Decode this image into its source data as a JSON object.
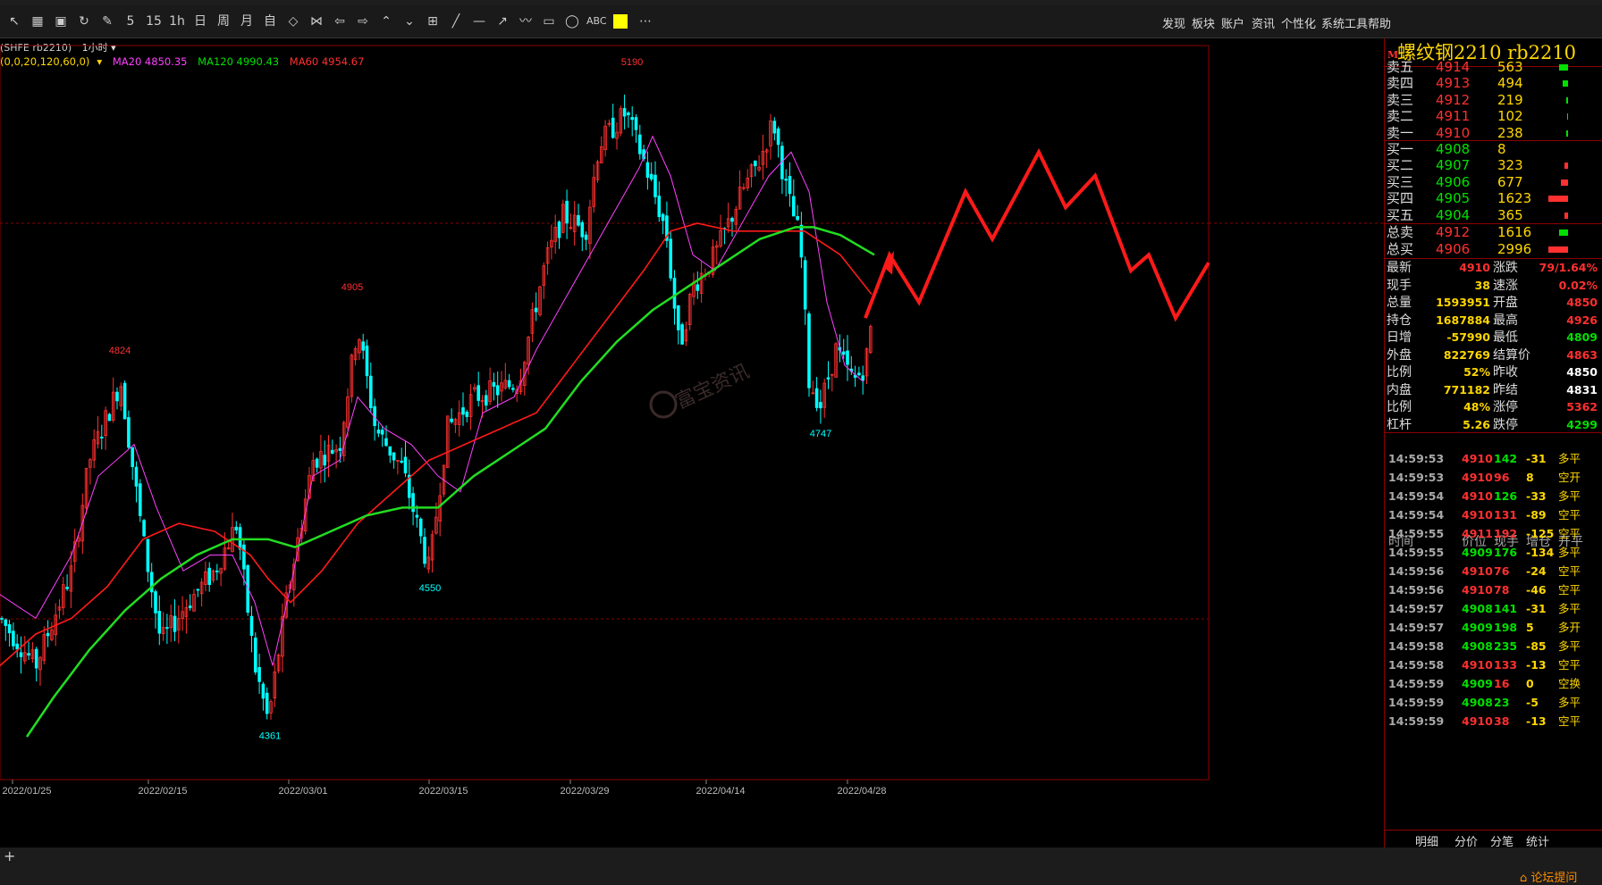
{
  "toolbar": {
    "tools": [
      "cursor-icon",
      "layout-icon",
      "save-icon",
      "refresh-icon",
      "draw-icon",
      "5",
      "15",
      "1h",
      "日",
      "周",
      "月",
      "自",
      "zoom-in-icon",
      "zoom-out-icon",
      "arrow-left-icon",
      "arrow-right-icon",
      "arrow-up-icon",
      "arrow-down-icon",
      "grid-icon",
      "line-icon",
      "hline-icon",
      "ray-icon",
      "wave-icon",
      "rect-icon",
      "ellipse-icon",
      "ABC",
      "color-swatch",
      "more-icon"
    ],
    "menu": [
      "发现",
      "板块",
      "账户",
      "资讯",
      "个性化",
      "系统工具",
      "帮助"
    ],
    "swatch_color": "#ffff00"
  },
  "chart": {
    "header": "(SHFE rb2210)",
    "period": "1小时",
    "params": "(0,0,20,120,60,0)",
    "ma20": "MA20 4850.35",
    "ma120": "MA120 4990.43",
    "ma60": "MA60 4954.67",
    "peak_labels": {
      "p1": "4824",
      "p2": "4905",
      "p3": "5190",
      "p4": "4747",
      "p5": "4550",
      "p6": "4361"
    },
    "x_labels": [
      "2022/01/25",
      "2022/02/15",
      "2022/03/01",
      "2022/03/15",
      "2022/03/29",
      "2022/04/14",
      "2022/04/28"
    ],
    "watermark": "富宝资讯",
    "colors": {
      "up": "#ff3030",
      "down": "#00ffff",
      "ma20": "#ff40ff",
      "ma60": "#ff1a1a",
      "ma120": "#22dd22",
      "forecast": "#ff1a1a"
    }
  },
  "quote": {
    "title": "螺纹钢2210  rb2210",
    "flag": "M",
    "asks": [
      {
        "label": "卖五",
        "price": "4914",
        "vol": "563"
      },
      {
        "label": "卖四",
        "price": "4913",
        "vol": "494"
      },
      {
        "label": "卖三",
        "price": "4912",
        "vol": "219"
      },
      {
        "label": "卖二",
        "price": "4911",
        "vol": "102"
      },
      {
        "label": "卖一",
        "price": "4910",
        "vol": "238"
      }
    ],
    "bids": [
      {
        "label": "买一",
        "price": "4908",
        "vol": "8"
      },
      {
        "label": "买二",
        "price": "4907",
        "vol": "323"
      },
      {
        "label": "买三",
        "price": "4906",
        "vol": "677"
      },
      {
        "label": "买四",
        "price": "4905",
        "vol": "1623"
      },
      {
        "label": "买五",
        "price": "4904",
        "vol": "365"
      }
    ],
    "totals": [
      {
        "label": "总卖",
        "price": "4912",
        "vol": "1616"
      },
      {
        "label": "总买",
        "price": "4906",
        "vol": "2996"
      }
    ],
    "stats": [
      {
        "l1": "最新",
        "v1": "4910",
        "l2": "涨跌",
        "v2": "79/1.64%"
      },
      {
        "l1": "现手",
        "v1": "38",
        "l2": "速涨",
        "v2": "0.02%"
      },
      {
        "l1": "总量",
        "v1": "1593951",
        "l2": "开盘",
        "v2": "4850"
      },
      {
        "l1": "持仓",
        "v1": "1687884",
        "l2": "最高",
        "v2": "4926"
      },
      {
        "l1": "日增",
        "v1": "-57990",
        "l2": "最低",
        "v2": "4809"
      },
      {
        "l1": "外盘",
        "v1": "822769",
        "l2": "结算价",
        "v2": "4863"
      },
      {
        "l1": "比例",
        "v1": "52%",
        "l2": "昨收",
        "v2": "4850"
      },
      {
        "l1": "内盘",
        "v1": "771182",
        "l2": "昨结",
        "v2": "4831"
      },
      {
        "l1": "比例",
        "v1": "48%",
        "l2": "涨停",
        "v2": "5362"
      },
      {
        "l1": "杠杆",
        "v1": "5.26",
        "l2": "跌停",
        "v2": "4299"
      }
    ],
    "trades_header": [
      "时间",
      "价位",
      "现手",
      "增仓",
      "开平"
    ],
    "trades": [
      [
        "14:59:53",
        "4910",
        "142",
        "-31",
        "多平"
      ],
      [
        "14:59:53",
        "4910",
        "96",
        "8",
        "空开"
      ],
      [
        "14:59:54",
        "4910",
        "126",
        "-33",
        "多平"
      ],
      [
        "14:59:54",
        "4910",
        "131",
        "-89",
        "空平"
      ],
      [
        "14:59:55",
        "4911",
        "192",
        "-125",
        "空平"
      ],
      [
        "14:59:55",
        "4909",
        "176",
        "-134",
        "多平"
      ],
      [
        "14:59:56",
        "4910",
        "76",
        "-24",
        "空平"
      ],
      [
        "14:59:56",
        "4910",
        "78",
        "-46",
        "空平"
      ],
      [
        "14:59:57",
        "4908",
        "141",
        "-31",
        "多平"
      ],
      [
        "14:59:57",
        "4909",
        "198",
        "5",
        "多开"
      ],
      [
        "14:59:58",
        "4908",
        "235",
        "-85",
        "多平"
      ],
      [
        "14:59:58",
        "4910",
        "133",
        "-13",
        "空平"
      ],
      [
        "14:59:59",
        "4909",
        "16",
        "0",
        "空换"
      ],
      [
        "14:59:59",
        "4908",
        "23",
        "-5",
        "多平"
      ],
      [
        "14:59:59",
        "4910",
        "38",
        "-13",
        "空平"
      ]
    ],
    "tabs": [
      "明细",
      "分价",
      "分笔",
      "统计"
    ]
  },
  "bottom": {
    "forum": "论坛提问"
  }
}
